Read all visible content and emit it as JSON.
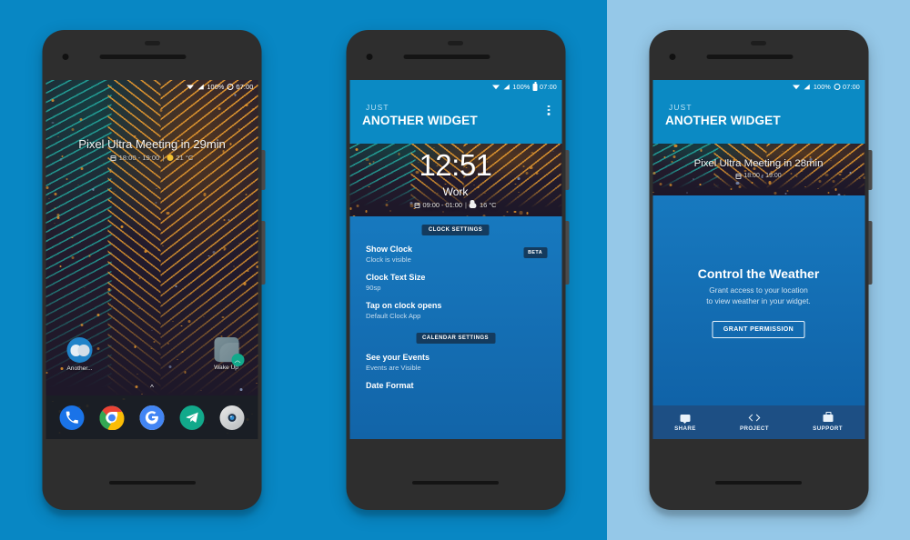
{
  "meta": {
    "app_name": "Just Another Widget",
    "panels": 3,
    "accent_blue": "#0b8ac4",
    "deep_blue": "#1264a8",
    "panel1_bg": "#0887c4",
    "panel2_bg": "#0887c4",
    "panel3_bg": "#95c8e8"
  },
  "status_bar": {
    "battery_percent": "100%",
    "time": "07:00",
    "wifi_icon": "wifi-icon",
    "signal_icon": "signal-icon",
    "battery_icon": "battery-icon"
  },
  "panel1": {
    "screen_name": "Android Home Screen",
    "widget": {
      "title": "Pixel Ultra Meeting in  29min",
      "event_time": "18:00 - 19:00",
      "separator": "|",
      "temperature": "21 °C",
      "calendar_icon": "calendar-icon",
      "weather_icon": "sun-icon"
    },
    "home_icons": [
      {
        "label": "Another...",
        "icon": "another-widget-icon"
      },
      {
        "label": "Wake Up",
        "icon": "wake-up-shortcut-icon"
      }
    ],
    "app_drawer_handle": "^",
    "dock": [
      {
        "name": "phone-icon",
        "label": "Phone"
      },
      {
        "name": "chrome-icon",
        "label": "Chrome"
      },
      {
        "name": "google-icon",
        "label": "Google"
      },
      {
        "name": "telegram-icon",
        "label": "Telegram"
      },
      {
        "name": "camera-icon",
        "label": "Camera"
      }
    ]
  },
  "panel2": {
    "header": {
      "eyebrow": "JUST",
      "title": "ANOTHER WIDGET",
      "overflow_icon": "more-vertical-icon"
    },
    "preview": {
      "clock": "12:51",
      "event_label": "Work",
      "event_time": "09:00 - 01:00",
      "separator": "|",
      "temperature": "16 °C",
      "calendar_icon": "calendar-icon",
      "weather_icon": "cloud-icon"
    },
    "sections": [
      {
        "chip": "CLOCK SETTINGS",
        "rows": [
          {
            "title": "Show Clock",
            "subtitle": "Clock is visible",
            "badge": "BETA"
          },
          {
            "title": "Clock Text Size",
            "subtitle": "90sp",
            "badge": ""
          },
          {
            "title": "Tap on clock opens",
            "subtitle": "Default Clock App",
            "badge": ""
          }
        ]
      },
      {
        "chip": "CALENDAR SETTINGS",
        "rows": [
          {
            "title": "See your Events",
            "subtitle": "Events are Visible",
            "badge": ""
          },
          {
            "title": "Date Format",
            "subtitle": "",
            "badge": ""
          }
        ]
      }
    ]
  },
  "panel3": {
    "header": {
      "eyebrow": "JUST",
      "title": "ANOTHER WIDGET"
    },
    "preview": {
      "title": "Pixel Ultra Meeting in  28min",
      "event_time": "18:00 - 19:00",
      "calendar_icon": "calendar-icon"
    },
    "weather_prompt": {
      "heading": "Control the Weather",
      "line1": "Grant access to your location",
      "line2": "to view weather in your widget.",
      "button": "GRANT PERMISSION"
    },
    "bottom_nav": [
      {
        "label": "SHARE",
        "icon": "chat-icon"
      },
      {
        "label": "PROJECT",
        "icon": "code-icon"
      },
      {
        "label": "SUPPORT",
        "icon": "briefcase-icon"
      }
    ]
  }
}
